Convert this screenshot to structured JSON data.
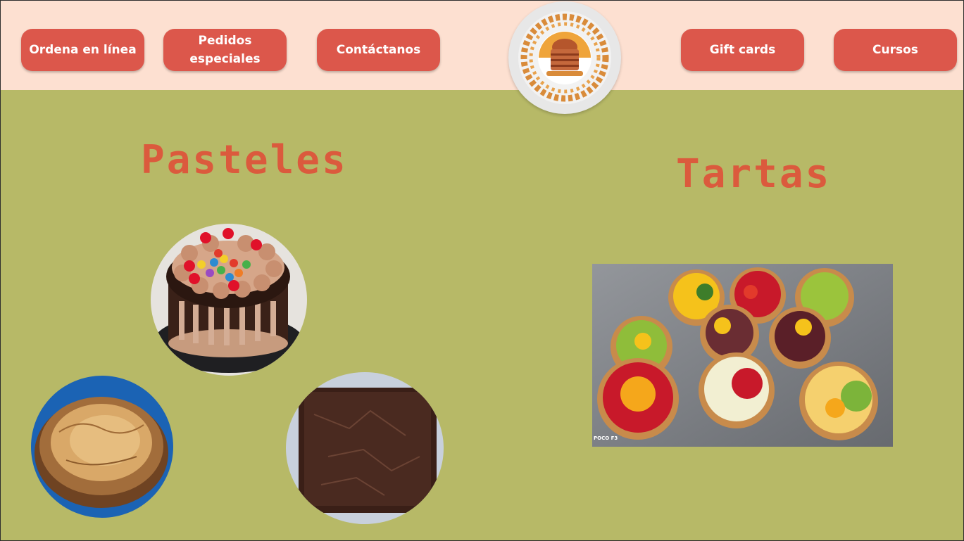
{
  "nav": {
    "items": [
      {
        "label": "Ordena en línea"
      },
      {
        "label": "Pedidos especiales"
      },
      {
        "label": "Contáctanos"
      },
      {
        "label": "Gift cards"
      },
      {
        "label": "Cursos"
      }
    ]
  },
  "logo": {
    "icon": "bakery-logo-icon"
  },
  "sections": {
    "pasteles": {
      "title": "Pasteles"
    },
    "tartas": {
      "title": "Tartas",
      "photo_watermark": "POCO F3"
    }
  },
  "colors": {
    "header_bg": "#fde0d1",
    "page_bg": "#b7b967",
    "button_bg": "#dc574b",
    "title": "#db5a3d"
  }
}
